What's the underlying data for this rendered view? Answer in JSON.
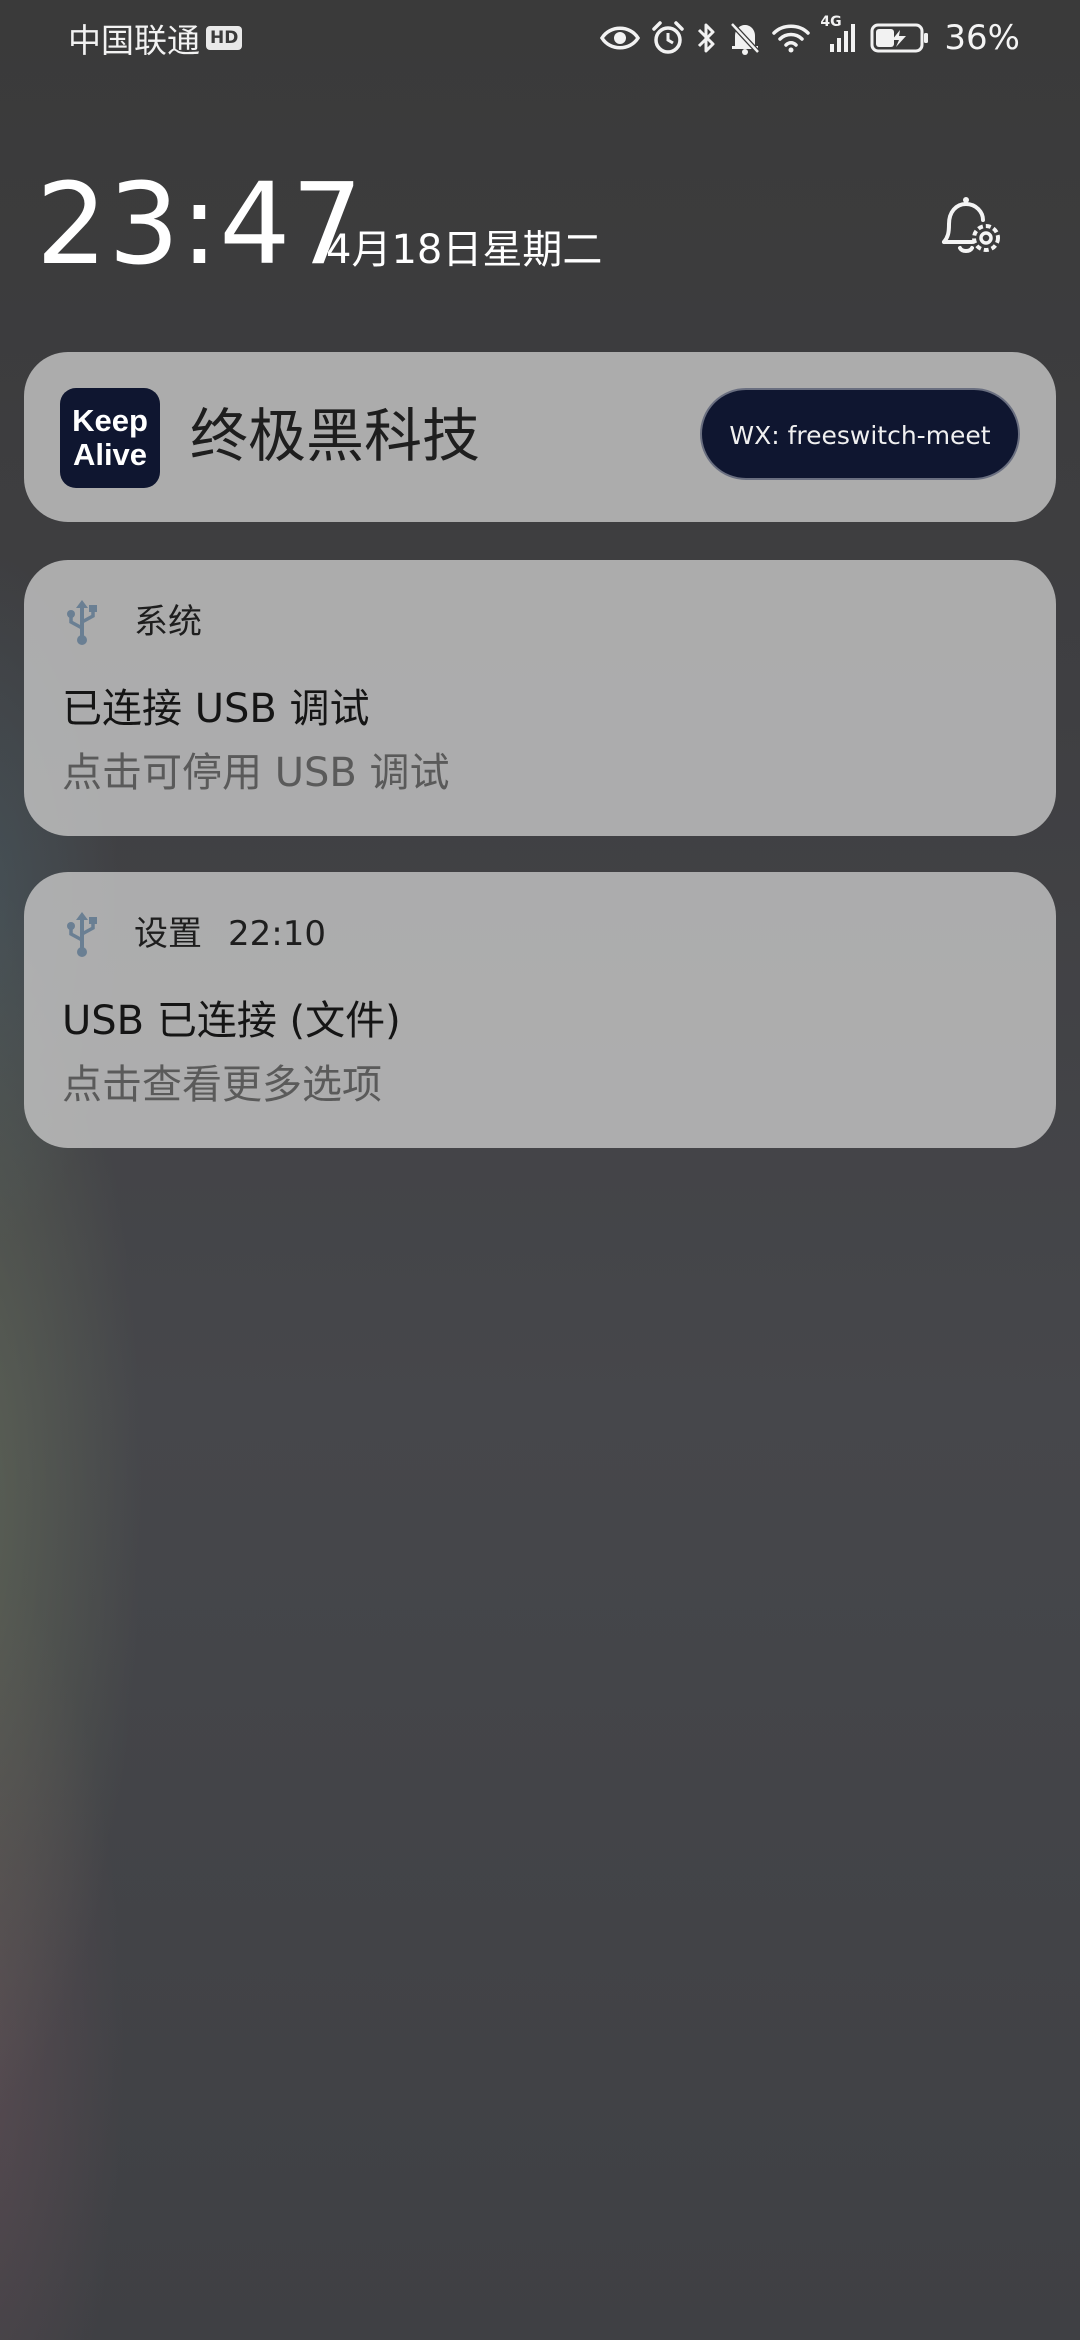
{
  "status_bar": {
    "carrier": "中国联通",
    "hd_badge": "HD",
    "network_type": "4G",
    "battery_percent": "36%",
    "icons": [
      "eye-icon",
      "alarm-icon",
      "bluetooth-icon",
      "mute-bell-icon",
      "wifi-icon",
      "cellular-signal-icon",
      "battery-charging-icon"
    ]
  },
  "lockscreen": {
    "time": "23:47",
    "date": "4月18日星期二",
    "settings_icon": "notification-settings-icon"
  },
  "notifications": [
    {
      "type": "app_banner",
      "app_icon_line1": "Keep",
      "app_icon_line2": "Alive",
      "title": "终极黑科技",
      "button_label": "WX: freeswitch-meet"
    },
    {
      "type": "system",
      "icon": "usb-icon",
      "source": "系统",
      "time": "",
      "title": "已连接 USB 调试",
      "text": "点击可停用 USB 调试"
    },
    {
      "type": "system",
      "icon": "usb-icon",
      "source": "设置",
      "time": "22:10",
      "title": "USB 已连接 (文件)",
      "text": "点击查看更多选项"
    }
  ],
  "colors": {
    "card_background": "#c4c4c4",
    "accent_dark": "#0f1630",
    "usb_icon": "#6a7f93"
  }
}
